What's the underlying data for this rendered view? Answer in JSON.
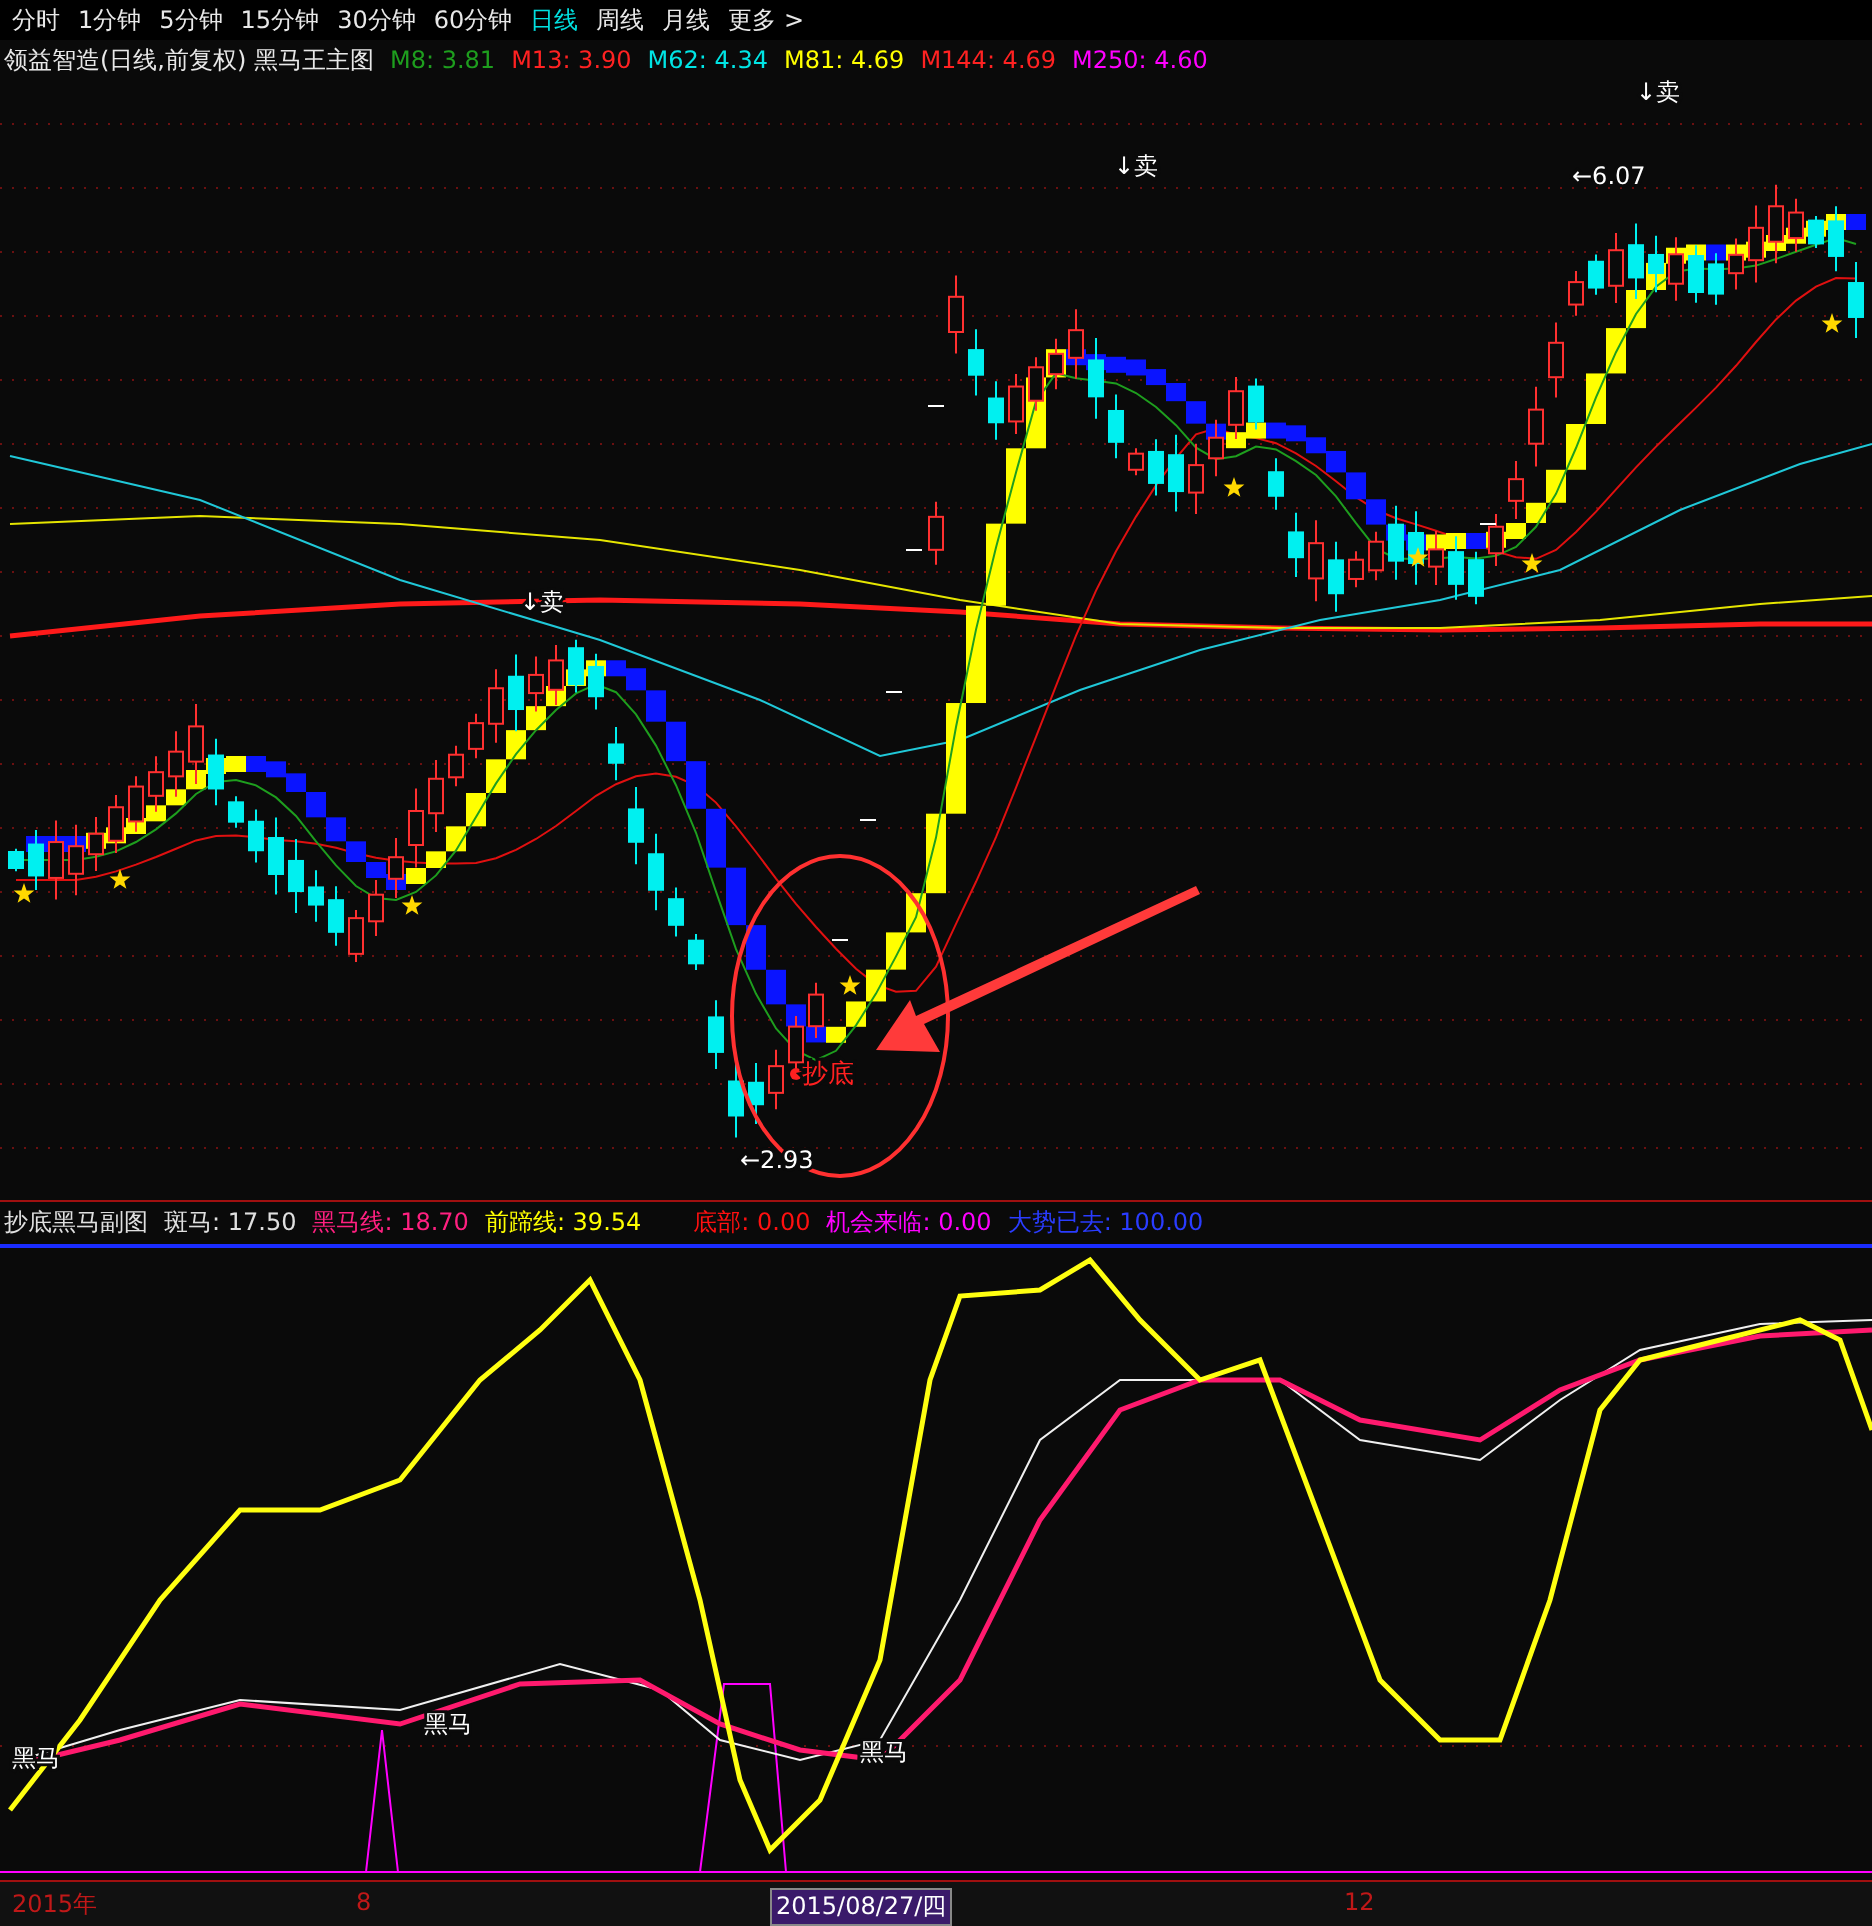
{
  "tabs": [
    {
      "label": "分时",
      "selected": false
    },
    {
      "label": "1分钟",
      "selected": false
    },
    {
      "label": "5分钟",
      "selected": false
    },
    {
      "label": "15分钟",
      "selected": false
    },
    {
      "label": "30分钟",
      "selected": false
    },
    {
      "label": "60分钟",
      "selected": false
    },
    {
      "label": "日线",
      "selected": true
    },
    {
      "label": "周线",
      "selected": false
    },
    {
      "label": "月线",
      "selected": false
    },
    {
      "label": "更多 >",
      "selected": false
    }
  ],
  "main_chart": {
    "title": "领益智造(日线,前复权) 黑马王主图",
    "legend": [
      {
        "text": "M8: 3.81",
        "color": "#1e9e1e"
      },
      {
        "text": "M13: 3.90",
        "color": "#ff2222"
      },
      {
        "text": "M62: 4.34",
        "color": "#00e5e5"
      },
      {
        "text": "M81: 4.69",
        "color": "#ffff00"
      },
      {
        "text": "M144: 4.69",
        "color": "#ff2222"
      },
      {
        "text": "M250: 4.60",
        "color": "#ff00ff"
      }
    ],
    "annotations": [
      {
        "kind": "signal",
        "text": "↓卖"
      },
      {
        "kind": "signal",
        "text": "↓卖"
      },
      {
        "kind": "signal",
        "text": "↓卖"
      },
      {
        "kind": "price",
        "text": "←6.07"
      },
      {
        "kind": "price",
        "text": "←2.93"
      },
      {
        "kind": "buy",
        "text": "抄底"
      }
    ]
  },
  "sub_chart": {
    "title": "抄底黑马副图",
    "legend": [
      {
        "text": "斑马: 17.50",
        "color": "#e0e0e0"
      },
      {
        "text": "黑马线: 18.70",
        "color": "#ff2080"
      },
      {
        "text": "前蹄线: 39.54",
        "color": "#ffff00"
      },
      {
        "text": "底部: 0.00",
        "color": "#ff1010"
      },
      {
        "text": "机会来临: 0.00",
        "color": "#ff00ff"
      },
      {
        "text": "大势已去: 100.00",
        "color": "#2a3cff"
      }
    ],
    "labels": [
      "黑马",
      "黑马",
      "黑马"
    ]
  },
  "x_axis": [
    {
      "kind": "tick",
      "text": "2015年"
    },
    {
      "kind": "tick",
      "text": "8"
    },
    {
      "kind": "cursor",
      "text": "2015/08/27/四"
    },
    {
      "kind": "tick",
      "text": "12"
    }
  ]
}
